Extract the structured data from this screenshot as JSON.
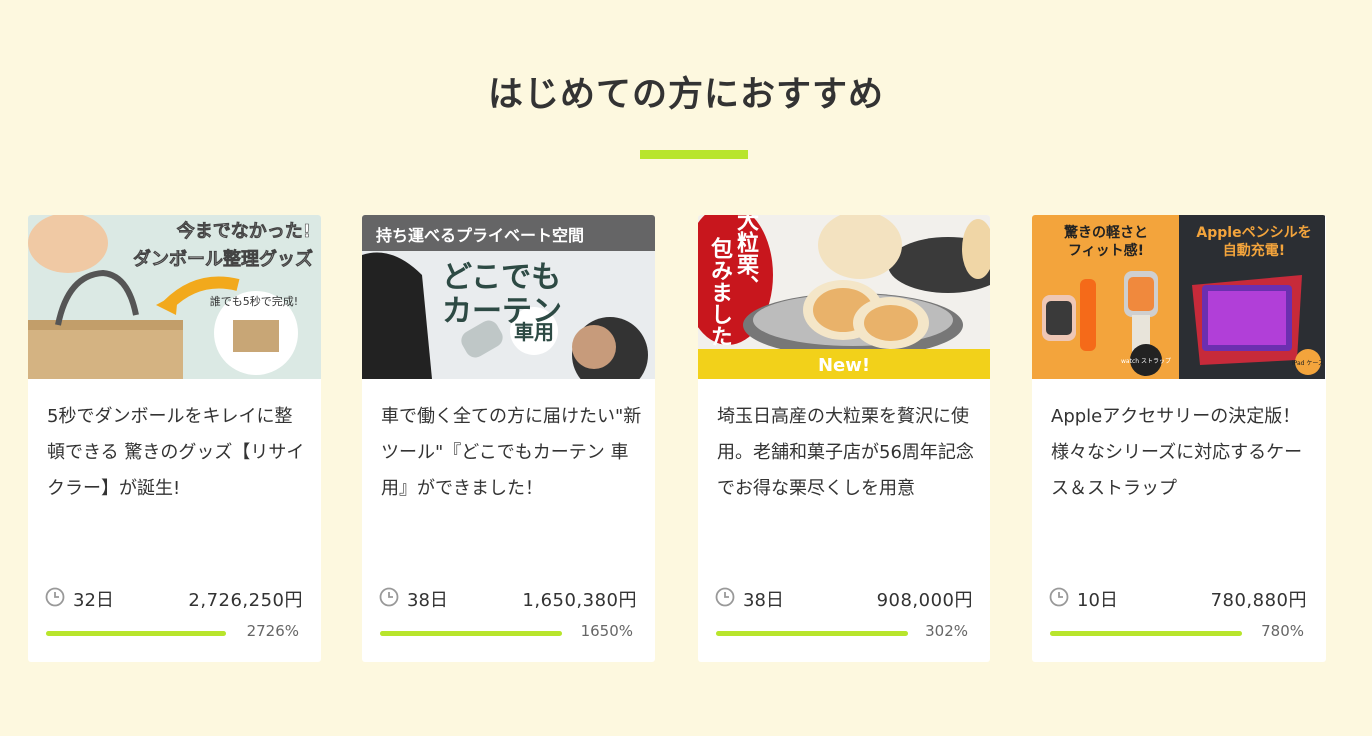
{
  "section": {
    "title": "はじめての方におすすめ"
  },
  "cards": [
    {
      "banner_lines": [
        "今までなかった!",
        "ダンボール整理グッズ"
      ],
      "badge": "誰でも5秒で完成!",
      "title": "5秒でダンボールをキレイに整頓できる 驚きのグッズ【リサイクラー】が誕生!",
      "days": "32日",
      "amount": "2,726,250円",
      "percent": "2726%",
      "progress": 1.0
    },
    {
      "banner_lines": [
        "持ち運べるプライベート空間",
        "どこでも",
        "カーテン"
      ],
      "badge": "車用",
      "title": "車で働く全ての方に届けたい\"新ツール\"『どこでもカーテン 車用』ができました！",
      "days": "38日",
      "amount": "1,650,380円",
      "percent": "1650%",
      "progress": 1.0
    },
    {
      "banner_lines": [
        "大粒栗、",
        "包みました"
      ],
      "badge": "New!",
      "title": "埼玉日高産の大粒栗を贅沢に使用。老舗和菓子店が56周年記念でお得な栗尽くしを用意",
      "days": "38日",
      "amount": "908,000円",
      "percent": "302%",
      "progress": 1.0
    },
    {
      "banner_lines": [
        "驚きの軽さと",
        "フィット感!",
        "Appleペンシルを",
        "自動充電!"
      ],
      "badges": [
        "watch ストラップ",
        "iPad ケース"
      ],
      "title": "Appleアクセサリーの決定版！様々なシリーズに対応するケース＆ストラップ",
      "days": "10日",
      "amount": "780,880円",
      "percent": "780%",
      "progress": 1.0
    }
  ],
  "colors": {
    "accent": "#b8e52c",
    "background": "#fdf8df"
  }
}
